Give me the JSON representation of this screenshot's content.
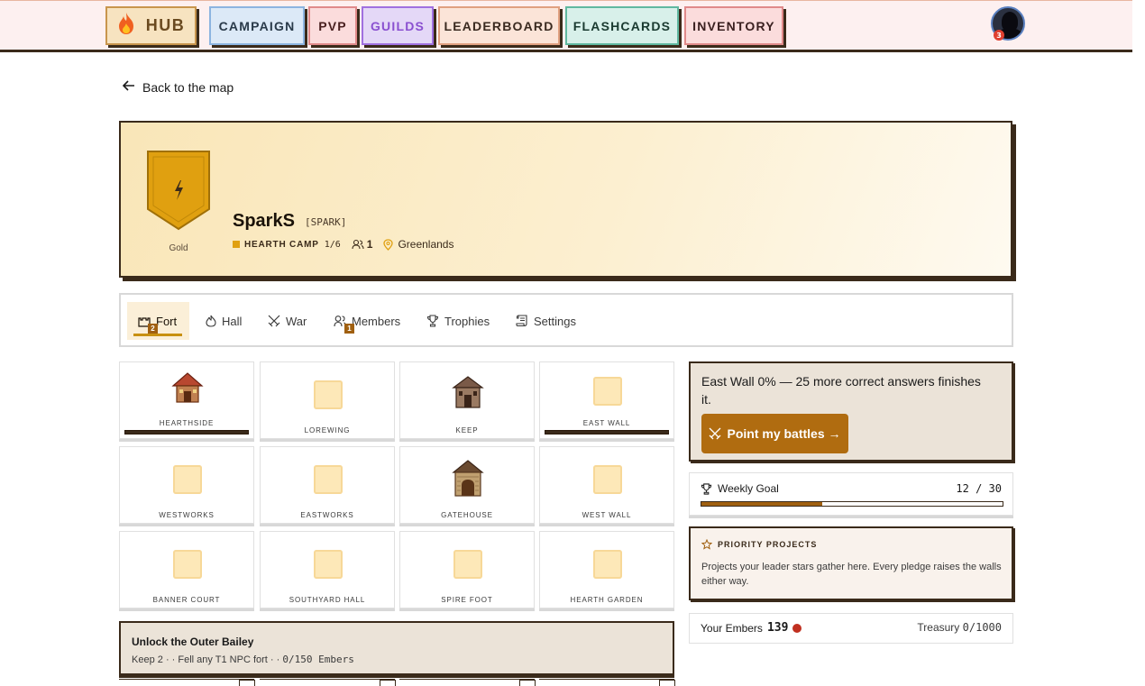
{
  "nav": {
    "hub": "HUB",
    "campaign": "CAMPAIGN",
    "pvp": "PVP",
    "guilds": "GUILDS",
    "leaderboard": "LEADERBOARD",
    "flashcards": "FLASHCARDS",
    "inventory": "INVENTORY",
    "avatar_badge": "3"
  },
  "back_link": "Back to the map",
  "guild": {
    "rank_label": "Gold",
    "name": "SparkS",
    "tag": "[SPARK]",
    "tier": "HEARTH CAMP",
    "tier_progress": "1/6",
    "members": "1",
    "region": "Greenlands",
    "shield_color": "#e0a010"
  },
  "tabs": [
    {
      "label": "Fort",
      "badge": "2"
    },
    {
      "label": "Hall"
    },
    {
      "label": "War"
    },
    {
      "label": "Members",
      "badge": "1"
    },
    {
      "label": "Trophies"
    },
    {
      "label": "Settings"
    }
  ],
  "buildings": [
    "HEARTHSIDE",
    "LOREWING",
    "KEEP",
    "EAST WALL",
    "WESTWORKS",
    "EASTWORKS",
    "GATEHOUSE",
    "WEST WALL",
    "BANNER COURT",
    "SOUTHYARD HALL",
    "SPIRE FOOT",
    "HEARTH GARDEN"
  ],
  "callout": {
    "text": "East Wall 0% — 25 more correct answers finishes it.",
    "button": "Point my battles →"
  },
  "weekly": {
    "title": "Weekly Goal",
    "count": "12 / 30",
    "progress": 0.4
  },
  "priority": {
    "title": "PRIORITY PROJECTS",
    "body": "Projects your leader stars gather here. Every pledge raises the walls either way."
  },
  "embers": {
    "label": "Your Embers",
    "value": "139",
    "treasury_label": "Treasury",
    "treasury_value": "0/1000"
  },
  "unlock": {
    "title": "Unlock the Outer Bailey",
    "req1": "Keep 2",
    "req2": "Fell any T1 NPC fort",
    "req3": "0/150 Embers"
  }
}
